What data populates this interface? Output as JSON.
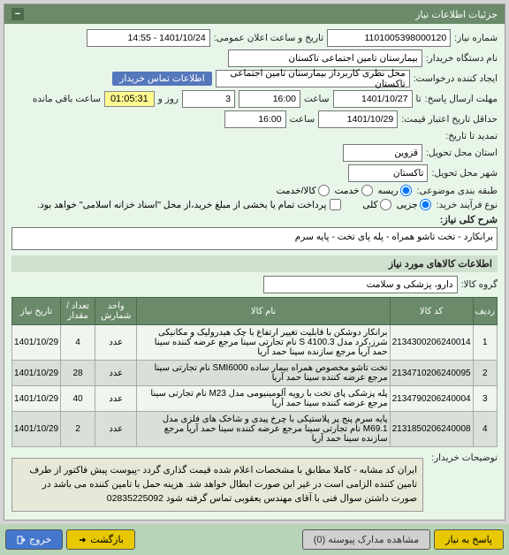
{
  "header": {
    "title": "جزئیات اطلاعات نیاز"
  },
  "fields": {
    "req_no_lbl": "شماره نیاز:",
    "req_no": "1101005398000120",
    "pub_dt_lbl": "تاریخ و ساعت اعلان عمومی:",
    "pub_dt": "1401/10/24 - 14:55",
    "buyer_lbl": "نام دستگاه خریدار:",
    "buyer": "بیمارستان تامین اجتماعی تاکستان",
    "creator_lbl": "ایجاد کننده درخواست:",
    "creator": "محل نظری کاربرداز بیمارستان تامین اجتماعی تاکستان",
    "contact_link": "اطلاعات تماس خریدار",
    "deadline_lbl": "مهلت ارسال پاسخ:",
    "until_lbl": "تا",
    "deadline_date": "1401/10/27",
    "time_lbl": "ساعت",
    "deadline_time": "16:00",
    "days": "3",
    "days_lbl": "روز و",
    "countdown": "01:05:31",
    "remain_lbl": "ساعت باقی مانده",
    "validity_lbl": "حداقل تاریخ اعتبار قیمت:",
    "validity_date": "1401/10/29",
    "validity_time": "16:00",
    "extra_lbl": "تمدید تا تاریخ:",
    "province_lbl": "استان محل تحویل:",
    "province": "قزوین",
    "city_lbl": "شهر محل تحویل:",
    "city": "تاکستان",
    "class_lbl": "طبقه بندی موضوعی:",
    "class_prod": "ریسه",
    "class_srv": "خدمت",
    "class_both": "کالا/خدمت",
    "proc_lbl": "نوع فرآیند خرید:",
    "proc_partly": "جزیی",
    "proc_full": "کلی",
    "pay_note": "پرداخت تمام یا بخشی از مبلغ خرید،از محل \"اسناد خزانه اسلامی\" خواهد بود.",
    "summary_lbl": "شرح کلی نیاز:",
    "summary": "برانکارد - تخت تاشو همراه - پله پای تخت - پایه سرم",
    "items_header": "اطلاعات کالاهای مورد نیاز",
    "group_lbl": "گروه کالا:",
    "group": "دارو، پزشکی و سلامت",
    "buyer_notes_lbl": "توضیحات خریدار:",
    "buyer_notes": "ایران کد مشابه - کاملا مطابق با مشخصات اعلام شده قیمت گذاری گردد -پیوست پیش فاکتور از طرف تامین کننده الزامی است در غیر این صورت ابطال خواهد شد. هزینه حمل با تامین کننده می باشد در صورت داشتن سوال فنی با آقای مهندس یعقوبی تماس گرفته شود 02835225092"
  },
  "table": {
    "cols": {
      "row": "ردیف",
      "code": "کد کالا",
      "name": "نام کالا",
      "unit": "واحد شمارش",
      "qty": "تعداد / مقدار",
      "date": "تاریخ نیاز"
    },
    "rows": [
      {
        "r": "1",
        "code": "2134300206240014",
        "name": "برانکار دوشکن با قابلیت تغییر ارتفاع با چک هیدرولیک و مکانیکی شرز،کرد مدل S 4100.3 نام تجارتی سینا مرجع عرضه کننده سینا حمد آریا مرجع سازنده سینا حمد آریا",
        "unit": "عدد",
        "qty": "4",
        "date": "1401/10/29"
      },
      {
        "r": "2",
        "code": "2134710206240095",
        "name": "تخت تاشو مخصوص همراه بیمار ساده SMI6000 نام تجارتی سینا مرجع عرضه کننده سینا حمد آریا",
        "unit": "عدد",
        "qty": "28",
        "date": "1401/10/29"
      },
      {
        "r": "3",
        "code": "2134790206240004",
        "name": "پله پزشکی پای تخت با رویه آلومینیومی مدل M23 نام تجارتی سینا مرجع عرضه کننده سینا حمد آریا",
        "unit": "عدد",
        "qty": "40",
        "date": "1401/10/29"
      },
      {
        "r": "4",
        "code": "2131850206240008",
        "name": "پایه سرم پنج پر پلاستیکی با چرخ پیدی و شاخک های فلزی مدل M69.1 نام تجارتی سینا مرجع عرضه کننده سینا حمد آریا مرجع سازنده سینا حمد آریا",
        "unit": "عدد",
        "qty": "2",
        "date": "1401/10/29"
      }
    ]
  },
  "bottom": {
    "back": "پاسخ به نیاز",
    "view_attach": "مشاهده مدارک پیوسته (0)",
    "return": "بازگشت",
    "exit": "خروج"
  }
}
